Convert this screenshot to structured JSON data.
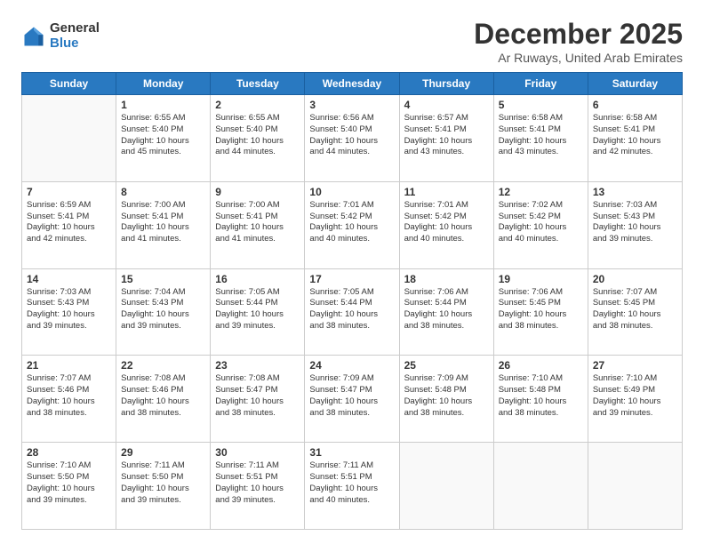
{
  "logo": {
    "general": "General",
    "blue": "Blue"
  },
  "title": "December 2025",
  "location": "Ar Ruways, United Arab Emirates",
  "headers": [
    "Sunday",
    "Monday",
    "Tuesday",
    "Wednesday",
    "Thursday",
    "Friday",
    "Saturday"
  ],
  "weeks": [
    [
      {
        "day": "",
        "content": ""
      },
      {
        "day": "1",
        "content": "Sunrise: 6:55 AM\nSunset: 5:40 PM\nDaylight: 10 hours\nand 45 minutes."
      },
      {
        "day": "2",
        "content": "Sunrise: 6:55 AM\nSunset: 5:40 PM\nDaylight: 10 hours\nand 44 minutes."
      },
      {
        "day": "3",
        "content": "Sunrise: 6:56 AM\nSunset: 5:40 PM\nDaylight: 10 hours\nand 44 minutes."
      },
      {
        "day": "4",
        "content": "Sunrise: 6:57 AM\nSunset: 5:41 PM\nDaylight: 10 hours\nand 43 minutes."
      },
      {
        "day": "5",
        "content": "Sunrise: 6:58 AM\nSunset: 5:41 PM\nDaylight: 10 hours\nand 43 minutes."
      },
      {
        "day": "6",
        "content": "Sunrise: 6:58 AM\nSunset: 5:41 PM\nDaylight: 10 hours\nand 42 minutes."
      }
    ],
    [
      {
        "day": "7",
        "content": "Sunrise: 6:59 AM\nSunset: 5:41 PM\nDaylight: 10 hours\nand 42 minutes."
      },
      {
        "day": "8",
        "content": "Sunrise: 7:00 AM\nSunset: 5:41 PM\nDaylight: 10 hours\nand 41 minutes."
      },
      {
        "day": "9",
        "content": "Sunrise: 7:00 AM\nSunset: 5:41 PM\nDaylight: 10 hours\nand 41 minutes."
      },
      {
        "day": "10",
        "content": "Sunrise: 7:01 AM\nSunset: 5:42 PM\nDaylight: 10 hours\nand 40 minutes."
      },
      {
        "day": "11",
        "content": "Sunrise: 7:01 AM\nSunset: 5:42 PM\nDaylight: 10 hours\nand 40 minutes."
      },
      {
        "day": "12",
        "content": "Sunrise: 7:02 AM\nSunset: 5:42 PM\nDaylight: 10 hours\nand 40 minutes."
      },
      {
        "day": "13",
        "content": "Sunrise: 7:03 AM\nSunset: 5:43 PM\nDaylight: 10 hours\nand 39 minutes."
      }
    ],
    [
      {
        "day": "14",
        "content": "Sunrise: 7:03 AM\nSunset: 5:43 PM\nDaylight: 10 hours\nand 39 minutes."
      },
      {
        "day": "15",
        "content": "Sunrise: 7:04 AM\nSunset: 5:43 PM\nDaylight: 10 hours\nand 39 minutes."
      },
      {
        "day": "16",
        "content": "Sunrise: 7:05 AM\nSunset: 5:44 PM\nDaylight: 10 hours\nand 39 minutes."
      },
      {
        "day": "17",
        "content": "Sunrise: 7:05 AM\nSunset: 5:44 PM\nDaylight: 10 hours\nand 38 minutes."
      },
      {
        "day": "18",
        "content": "Sunrise: 7:06 AM\nSunset: 5:44 PM\nDaylight: 10 hours\nand 38 minutes."
      },
      {
        "day": "19",
        "content": "Sunrise: 7:06 AM\nSunset: 5:45 PM\nDaylight: 10 hours\nand 38 minutes."
      },
      {
        "day": "20",
        "content": "Sunrise: 7:07 AM\nSunset: 5:45 PM\nDaylight: 10 hours\nand 38 minutes."
      }
    ],
    [
      {
        "day": "21",
        "content": "Sunrise: 7:07 AM\nSunset: 5:46 PM\nDaylight: 10 hours\nand 38 minutes."
      },
      {
        "day": "22",
        "content": "Sunrise: 7:08 AM\nSunset: 5:46 PM\nDaylight: 10 hours\nand 38 minutes."
      },
      {
        "day": "23",
        "content": "Sunrise: 7:08 AM\nSunset: 5:47 PM\nDaylight: 10 hours\nand 38 minutes."
      },
      {
        "day": "24",
        "content": "Sunrise: 7:09 AM\nSunset: 5:47 PM\nDaylight: 10 hours\nand 38 minutes."
      },
      {
        "day": "25",
        "content": "Sunrise: 7:09 AM\nSunset: 5:48 PM\nDaylight: 10 hours\nand 38 minutes."
      },
      {
        "day": "26",
        "content": "Sunrise: 7:10 AM\nSunset: 5:48 PM\nDaylight: 10 hours\nand 38 minutes."
      },
      {
        "day": "27",
        "content": "Sunrise: 7:10 AM\nSunset: 5:49 PM\nDaylight: 10 hours\nand 39 minutes."
      }
    ],
    [
      {
        "day": "28",
        "content": "Sunrise: 7:10 AM\nSunset: 5:50 PM\nDaylight: 10 hours\nand 39 minutes."
      },
      {
        "day": "29",
        "content": "Sunrise: 7:11 AM\nSunset: 5:50 PM\nDaylight: 10 hours\nand 39 minutes."
      },
      {
        "day": "30",
        "content": "Sunrise: 7:11 AM\nSunset: 5:51 PM\nDaylight: 10 hours\nand 39 minutes."
      },
      {
        "day": "31",
        "content": "Sunrise: 7:11 AM\nSunset: 5:51 PM\nDaylight: 10 hours\nand 40 minutes."
      },
      {
        "day": "",
        "content": ""
      },
      {
        "day": "",
        "content": ""
      },
      {
        "day": "",
        "content": ""
      }
    ]
  ]
}
